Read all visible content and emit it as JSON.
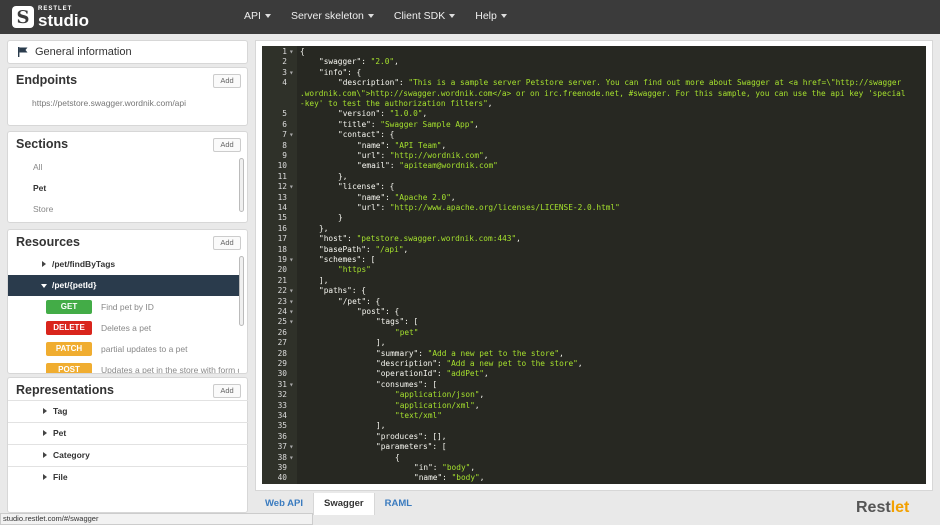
{
  "app": {
    "logo_small": "RESTLET",
    "logo_big": "studio",
    "logo_letter": "S"
  },
  "nav": [
    {
      "label": "API"
    },
    {
      "label": "Server skeleton"
    },
    {
      "label": "Client SDK"
    },
    {
      "label": "Help"
    }
  ],
  "general_info": {
    "label": "General information"
  },
  "endpoints": {
    "title": "Endpoints",
    "add_label": "Add",
    "url": "https://petstore.swagger.wordnik.com/api"
  },
  "sections": {
    "title": "Sections",
    "add_label": "Add",
    "items": [
      {
        "label": "All",
        "active": false
      },
      {
        "label": "Pet",
        "active": true
      },
      {
        "label": "Store",
        "active": false
      }
    ]
  },
  "resources": {
    "title": "Resources",
    "add_label": "Add",
    "items": [
      {
        "label": "/pet/findByTags"
      },
      {
        "label": "/pet/{petId}"
      }
    ],
    "methods": [
      {
        "method": "GET",
        "color": "#43ac47",
        "desc": "Find pet by ID"
      },
      {
        "method": "DELETE",
        "color": "#d9251c",
        "desc": "Deletes a pet"
      },
      {
        "method": "PATCH",
        "color": "#f0ad30",
        "desc": "partial updates to a pet"
      },
      {
        "method": "POST",
        "color": "#f0ad30",
        "desc": "Updates a pet in the store with form d"
      }
    ]
  },
  "representations": {
    "title": "Representations",
    "add_label": "Add",
    "items": [
      {
        "label": "Tag"
      },
      {
        "label": "Pet"
      },
      {
        "label": "Category"
      },
      {
        "label": "File"
      }
    ]
  },
  "status_bar": {
    "text": "studio.restlet.com/#/swagger"
  },
  "tabs": [
    {
      "label": "Web API",
      "active": false
    },
    {
      "label": "Swagger",
      "active": true
    },
    {
      "label": "RAML",
      "active": false
    }
  ],
  "brand": {
    "part1": "Rest",
    "part2": "let"
  },
  "code": [
    {
      "n": "1",
      "fold": "▾",
      "i": 0,
      "segs": [
        {
          "t": "{",
          "c": "k"
        }
      ]
    },
    {
      "n": "2",
      "fold": "",
      "i": 1,
      "segs": [
        {
          "t": "\"swagger\": ",
          "c": "k"
        },
        {
          "t": "\"2.0\"",
          "c": "s"
        },
        {
          "t": ",",
          "c": "k"
        }
      ]
    },
    {
      "n": "3",
      "fold": "▾",
      "i": 1,
      "segs": [
        {
          "t": "\"info\": {",
          "c": "k"
        }
      ]
    },
    {
      "n": "4",
      "fold": "",
      "i": 2,
      "segs": [
        {
          "t": "\"description\": ",
          "c": "k"
        },
        {
          "t": "\"This is a sample server Petstore server. You can find out more about Swagger at <a href=\\\"http://swagger",
          "c": "s"
        }
      ]
    },
    {
      "n": "",
      "fold": "",
      "i": 0,
      "segs": [
        {
          "t": ".wordnik.com\\\">http://swagger.wordnik.com</a> or on irc.freenode.net, #swagger. For this sample, you can use the api key 'special",
          "c": "s"
        }
      ]
    },
    {
      "n": "",
      "fold": "",
      "i": 0,
      "segs": [
        {
          "t": "-key' to test the authorization filters\"",
          "c": "s"
        },
        {
          "t": ",",
          "c": "k"
        }
      ]
    },
    {
      "n": "5",
      "fold": "",
      "i": 2,
      "segs": [
        {
          "t": "\"version\": ",
          "c": "k"
        },
        {
          "t": "\"1.0.0\"",
          "c": "s"
        },
        {
          "t": ",",
          "c": "k"
        }
      ]
    },
    {
      "n": "6",
      "fold": "",
      "i": 2,
      "segs": [
        {
          "t": "\"title\": ",
          "c": "k"
        },
        {
          "t": "\"Swagger Sample App\"",
          "c": "s"
        },
        {
          "t": ",",
          "c": "k"
        }
      ]
    },
    {
      "n": "7",
      "fold": "▾",
      "i": 2,
      "segs": [
        {
          "t": "\"contact\": {",
          "c": "k"
        }
      ]
    },
    {
      "n": "8",
      "fold": "",
      "i": 3,
      "segs": [
        {
          "t": "\"name\": ",
          "c": "k"
        },
        {
          "t": "\"API Team\"",
          "c": "s"
        },
        {
          "t": ",",
          "c": "k"
        }
      ]
    },
    {
      "n": "9",
      "fold": "",
      "i": 3,
      "segs": [
        {
          "t": "\"url\": ",
          "c": "k"
        },
        {
          "t": "\"http://wordnik.com\"",
          "c": "s"
        },
        {
          "t": ",",
          "c": "k"
        }
      ]
    },
    {
      "n": "10",
      "fold": "",
      "i": 3,
      "segs": [
        {
          "t": "\"email\": ",
          "c": "k"
        },
        {
          "t": "\"apiteam@wordnik.com\"",
          "c": "s"
        }
      ]
    },
    {
      "n": "11",
      "fold": "",
      "i": 2,
      "segs": [
        {
          "t": "},",
          "c": "k"
        }
      ]
    },
    {
      "n": "12",
      "fold": "▾",
      "i": 2,
      "segs": [
        {
          "t": "\"license\": {",
          "c": "k"
        }
      ]
    },
    {
      "n": "13",
      "fold": "",
      "i": 3,
      "segs": [
        {
          "t": "\"name\": ",
          "c": "k"
        },
        {
          "t": "\"Apache 2.0\"",
          "c": "s"
        },
        {
          "t": ",",
          "c": "k"
        }
      ]
    },
    {
      "n": "14",
      "fold": "",
      "i": 3,
      "segs": [
        {
          "t": "\"url\": ",
          "c": "k"
        },
        {
          "t": "\"http://www.apache.org/licenses/LICENSE-2.0.html\"",
          "c": "s"
        }
      ]
    },
    {
      "n": "15",
      "fold": "",
      "i": 2,
      "segs": [
        {
          "t": "}",
          "c": "k"
        }
      ]
    },
    {
      "n": "16",
      "fold": "",
      "i": 1,
      "segs": [
        {
          "t": "},",
          "c": "k"
        }
      ]
    },
    {
      "n": "17",
      "fold": "",
      "i": 1,
      "segs": [
        {
          "t": "\"host\": ",
          "c": "k"
        },
        {
          "t": "\"petstore.swagger.wordnik.com:443\"",
          "c": "s"
        },
        {
          "t": ",",
          "c": "k"
        }
      ]
    },
    {
      "n": "18",
      "fold": "",
      "i": 1,
      "segs": [
        {
          "t": "\"basePath\": ",
          "c": "k"
        },
        {
          "t": "\"/api\"",
          "c": "s"
        },
        {
          "t": ",",
          "c": "k"
        }
      ]
    },
    {
      "n": "19",
      "fold": "▾",
      "i": 1,
      "segs": [
        {
          "t": "\"schemes\": [",
          "c": "k"
        }
      ]
    },
    {
      "n": "20",
      "fold": "",
      "i": 2,
      "segs": [
        {
          "t": "\"https\"",
          "c": "s"
        }
      ]
    },
    {
      "n": "21",
      "fold": "",
      "i": 1,
      "segs": [
        {
          "t": "],",
          "c": "k"
        }
      ]
    },
    {
      "n": "22",
      "fold": "▾",
      "i": 1,
      "segs": [
        {
          "t": "\"paths\": {",
          "c": "k"
        }
      ]
    },
    {
      "n": "23",
      "fold": "▾",
      "i": 2,
      "segs": [
        {
          "t": "\"/pet\": {",
          "c": "k"
        }
      ]
    },
    {
      "n": "24",
      "fold": "▾",
      "i": 3,
      "segs": [
        {
          "t": "\"post\": {",
          "c": "k"
        }
      ]
    },
    {
      "n": "25",
      "fold": "▾",
      "i": 4,
      "segs": [
        {
          "t": "\"tags\": [",
          "c": "k"
        }
      ]
    },
    {
      "n": "26",
      "fold": "",
      "i": 5,
      "segs": [
        {
          "t": "\"pet\"",
          "c": "s"
        }
      ]
    },
    {
      "n": "27",
      "fold": "",
      "i": 4,
      "segs": [
        {
          "t": "],",
          "c": "k"
        }
      ]
    },
    {
      "n": "28",
      "fold": "",
      "i": 4,
      "segs": [
        {
          "t": "\"summary\": ",
          "c": "k"
        },
        {
          "t": "\"Add a new pet to the store\"",
          "c": "s"
        },
        {
          "t": ",",
          "c": "k"
        }
      ]
    },
    {
      "n": "29",
      "fold": "",
      "i": 4,
      "segs": [
        {
          "t": "\"description\": ",
          "c": "k"
        },
        {
          "t": "\"Add a new pet to the store\"",
          "c": "s"
        },
        {
          "t": ",",
          "c": "k"
        }
      ]
    },
    {
      "n": "30",
      "fold": "",
      "i": 4,
      "segs": [
        {
          "t": "\"operationId\": ",
          "c": "k"
        },
        {
          "t": "\"addPet\"",
          "c": "s"
        },
        {
          "t": ",",
          "c": "k"
        }
      ]
    },
    {
      "n": "31",
      "fold": "▾",
      "i": 4,
      "segs": [
        {
          "t": "\"consumes\": [",
          "c": "k"
        }
      ]
    },
    {
      "n": "32",
      "fold": "",
      "i": 5,
      "segs": [
        {
          "t": "\"application/json\"",
          "c": "s"
        },
        {
          "t": ",",
          "c": "k"
        }
      ]
    },
    {
      "n": "33",
      "fold": "",
      "i": 5,
      "segs": [
        {
          "t": "\"application/xml\"",
          "c": "s"
        },
        {
          "t": ",",
          "c": "k"
        }
      ]
    },
    {
      "n": "34",
      "fold": "",
      "i": 5,
      "segs": [
        {
          "t": "\"text/xml\"",
          "c": "s"
        }
      ]
    },
    {
      "n": "35",
      "fold": "",
      "i": 4,
      "segs": [
        {
          "t": "],",
          "c": "k"
        }
      ]
    },
    {
      "n": "36",
      "fold": "",
      "i": 4,
      "segs": [
        {
          "t": "\"produces\": [],",
          "c": "k"
        }
      ]
    },
    {
      "n": "37",
      "fold": "▾",
      "i": 4,
      "segs": [
        {
          "t": "\"parameters\": [",
          "c": "k"
        }
      ]
    },
    {
      "n": "38",
      "fold": "▾",
      "i": 5,
      "segs": [
        {
          "t": "{",
          "c": "k"
        }
      ]
    },
    {
      "n": "39",
      "fold": "",
      "i": 6,
      "segs": [
        {
          "t": "\"in\": ",
          "c": "k"
        },
        {
          "t": "\"body\"",
          "c": "s"
        },
        {
          "t": ",",
          "c": "k"
        }
      ]
    },
    {
      "n": "40",
      "fold": "",
      "i": 6,
      "segs": [
        {
          "t": "\"name\": ",
          "c": "k"
        },
        {
          "t": "\"body\"",
          "c": "s"
        },
        {
          "t": ",",
          "c": "k"
        }
      ]
    }
  ]
}
